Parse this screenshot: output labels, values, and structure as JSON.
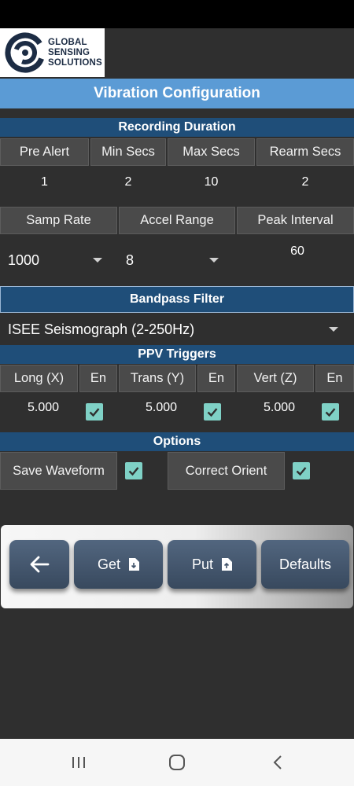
{
  "logo": {
    "line1": "GLOBAL",
    "line2": "SENSING",
    "line3": "SOLUTIONS"
  },
  "title": "Vibration Configuration",
  "recording": {
    "header": "Recording Duration",
    "labels": [
      "Pre Alert",
      "Min Secs",
      "Max Secs",
      "Rearm Secs"
    ],
    "values": [
      "1",
      "2",
      "10",
      "2"
    ]
  },
  "sampling": {
    "labels": [
      "Samp Rate",
      "Accel Range",
      "Peak Interval"
    ],
    "samp_rate_value": "1000",
    "accel_range_value": "8",
    "peak_interval_value": "60"
  },
  "bandpass": {
    "header": "Bandpass Filter",
    "value": "ISEE Seismograph (2-250Hz)"
  },
  "ppv": {
    "header": "PPV Triggers",
    "labels": [
      "Long (X)",
      "Trans (Y)",
      "Vert (Z)"
    ],
    "en_label": "En",
    "values": [
      "5.000",
      "5.000",
      "5.000"
    ],
    "enabled": [
      true,
      true,
      true
    ]
  },
  "options": {
    "header": "Options",
    "save_waveform_label": "Save Waveform",
    "save_waveform_checked": true,
    "correct_orient_label": "Correct Orient",
    "correct_orient_checked": true
  },
  "buttons": {
    "get": "Get",
    "put": "Put",
    "defaults": "Defaults"
  },
  "colors": {
    "title_bar": "#5b9bd5",
    "section_header": "#1f4e79",
    "checkbox": "#7fd1c6",
    "button": "#42546b"
  },
  "icons": {
    "back": "arrow-left-icon",
    "get": "file-download-icon",
    "put": "file-upload-icon",
    "nav_recents": "recents-icon",
    "nav_home": "home-icon",
    "nav_back": "back-chevron-icon"
  }
}
